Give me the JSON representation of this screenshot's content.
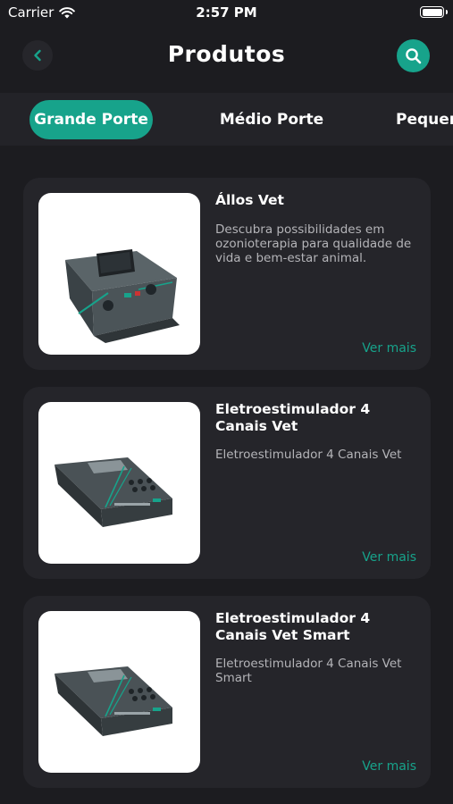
{
  "status": {
    "carrier": "Carrier",
    "time": "2:57 PM"
  },
  "header": {
    "title": "Produtos"
  },
  "tabs": [
    {
      "label": "Grande Porte",
      "active": true
    },
    {
      "label": "Médio Porte",
      "active": false
    },
    {
      "label": "Pequeno Porte",
      "active": false
    }
  ],
  "products": [
    {
      "title": "Állos Vet",
      "description": "Descubra possibilidades em ozonioterapia para qualidade de vida e bem-estar animal.",
      "more_label": "Ver mais"
    },
    {
      "title": "Eletroestimulador 4 Canais Vet",
      "description": "Eletroestimulador 4 Canais Vet",
      "more_label": "Ver mais"
    },
    {
      "title": "Eletroestimulador 4 Canais Vet Smart",
      "description": "Eletroestimulador 4 Canais Vet Smart",
      "more_label": "Ver mais"
    }
  ],
  "colors": {
    "accent": "#17a38b",
    "background": "#1c1c20",
    "card": "#25252a"
  },
  "icons": {
    "back": "chevron-left-icon",
    "search": "search-icon",
    "wifi": "wifi-icon",
    "battery": "battery-icon"
  }
}
